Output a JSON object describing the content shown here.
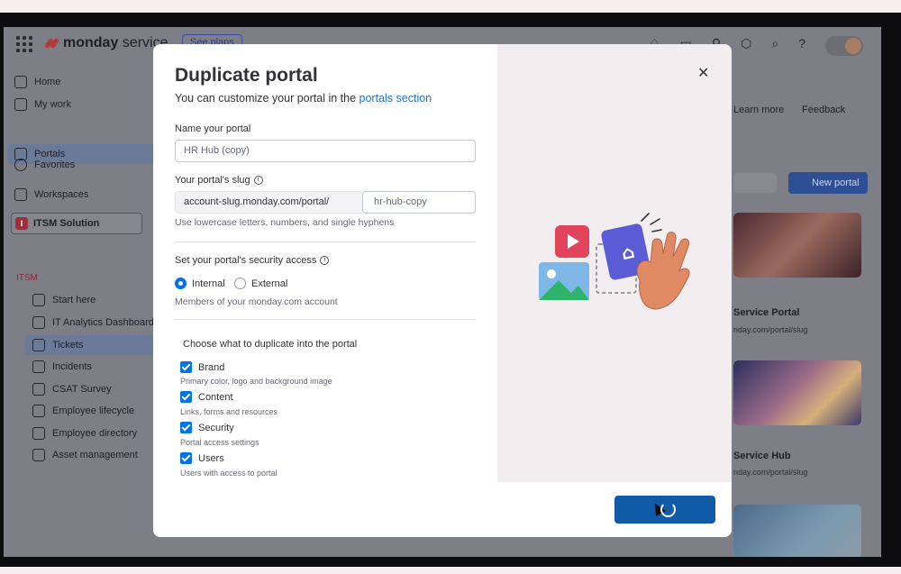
{
  "app": {
    "brand_bold": "monday",
    "brand_light": " service",
    "see_plans": "See plans"
  },
  "sidebar": {
    "items": [
      {
        "label": "Home"
      },
      {
        "label": "My work"
      },
      {
        "label": "Portals"
      },
      {
        "label": "Favorites"
      },
      {
        "label": "Workspaces"
      }
    ],
    "workspace": {
      "badge": "I",
      "name": "ITSM Solution"
    },
    "folder": "ITSM",
    "boards": [
      {
        "label": "Start here"
      },
      {
        "label": "IT Analytics Dashboard"
      },
      {
        "label": "Tickets"
      },
      {
        "label": "Incidents"
      },
      {
        "label": "CSAT Survey"
      },
      {
        "label": "Employee lifecycle"
      },
      {
        "label": "Employee directory"
      },
      {
        "label": "Asset management"
      }
    ]
  },
  "background_right": {
    "learn_more": "Learn more",
    "feedback": "Feedback",
    "new_portal": "New portal",
    "cards": [
      {
        "title": "Service Portal",
        "url": "nday.com/portal/slug"
      },
      {
        "title": "Service Hub",
        "url": "nday.com/portal/slug"
      }
    ]
  },
  "modal": {
    "title": "Duplicate portal",
    "subtitle_prefix": "You can customize your portal in the ",
    "subtitle_link": "portals section",
    "name_label": "Name your portal",
    "name_value": "HR Hub (copy)",
    "slug_label": "Your portal's slug",
    "slug_prefix": "account-slug.monday.com/portal/",
    "slug_value": "hr-hub-copy",
    "slug_hint": "Use lowercase letters, numbers, and single hyphens",
    "security_label": "Set your portal's security access",
    "security_options": [
      "Internal",
      "External"
    ],
    "security_selected": "Internal",
    "security_hint": "Members of your monday.com account",
    "duplicate_title": "Choose what to duplicate into the portal",
    "duplicate_options": [
      {
        "label": "Brand",
        "desc": "Primary color, logo and background image",
        "checked": true
      },
      {
        "label": "Content",
        "desc": "Links, forms and resources",
        "checked": true
      },
      {
        "label": "Security",
        "desc": "Portal access settings",
        "checked": true
      },
      {
        "label": "Users",
        "desc": "Users with access to portal",
        "checked": true
      }
    ]
  },
  "colors": {
    "primary": "#0073ea",
    "button": "#0f5ba8",
    "illustration_red": "#e2445c",
    "illustration_purple": "#5b5bd6",
    "illustration_green": "#2fb36a",
    "illustration_blue": "#7fb8e8",
    "illustration_hand": "#e08a64"
  }
}
